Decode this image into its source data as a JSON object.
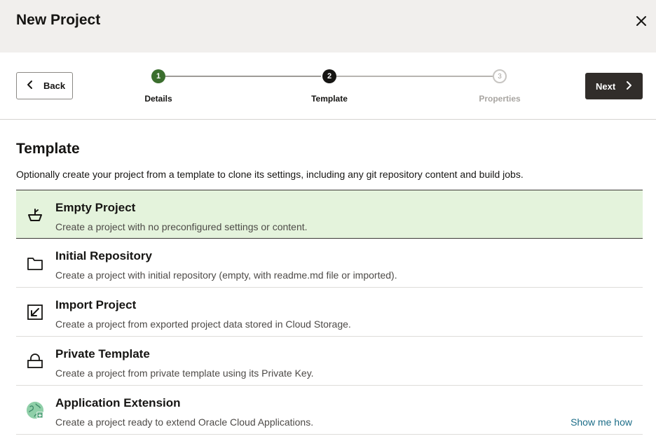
{
  "header": {
    "title": "New Project",
    "close_icon": "close-icon"
  },
  "train": {
    "back_label": "Back",
    "next_label": "Next",
    "steps": [
      {
        "number": "1",
        "label": "Details",
        "state": "done"
      },
      {
        "number": "2",
        "label": "Template",
        "state": "current"
      },
      {
        "number": "3",
        "label": "Properties",
        "state": "future"
      }
    ]
  },
  "section": {
    "title": "Template",
    "description": "Optionally create your project from a template to clone its settings, including any git repository content and build jobs."
  },
  "templates": [
    {
      "name": "Empty Project",
      "description": "Create a project with no preconfigured settings or content.",
      "icon": "bowl-icon",
      "selected": true
    },
    {
      "name": "Initial Repository",
      "description": "Create a project with initial repository (empty, with readme.md file or imported).",
      "icon": "folder-icon",
      "selected": false
    },
    {
      "name": "Import Project",
      "description": "Create a project from exported project data stored in Cloud Storage.",
      "icon": "import-arrow-icon",
      "selected": false
    },
    {
      "name": "Private Template",
      "description": "Create a project from private template using its Private Key.",
      "icon": "lock-icon",
      "selected": false
    },
    {
      "name": "Application Extension",
      "description": "Create a project ready to extend Oracle Cloud Applications.",
      "icon": "globe-extension-icon",
      "selected": false,
      "link": "Show me how"
    }
  ],
  "colors": {
    "selected_bg": "#e4f3dc",
    "done_step": "#3b6e2e",
    "primary_button": "#312d2a",
    "link": "#1c6d88"
  }
}
